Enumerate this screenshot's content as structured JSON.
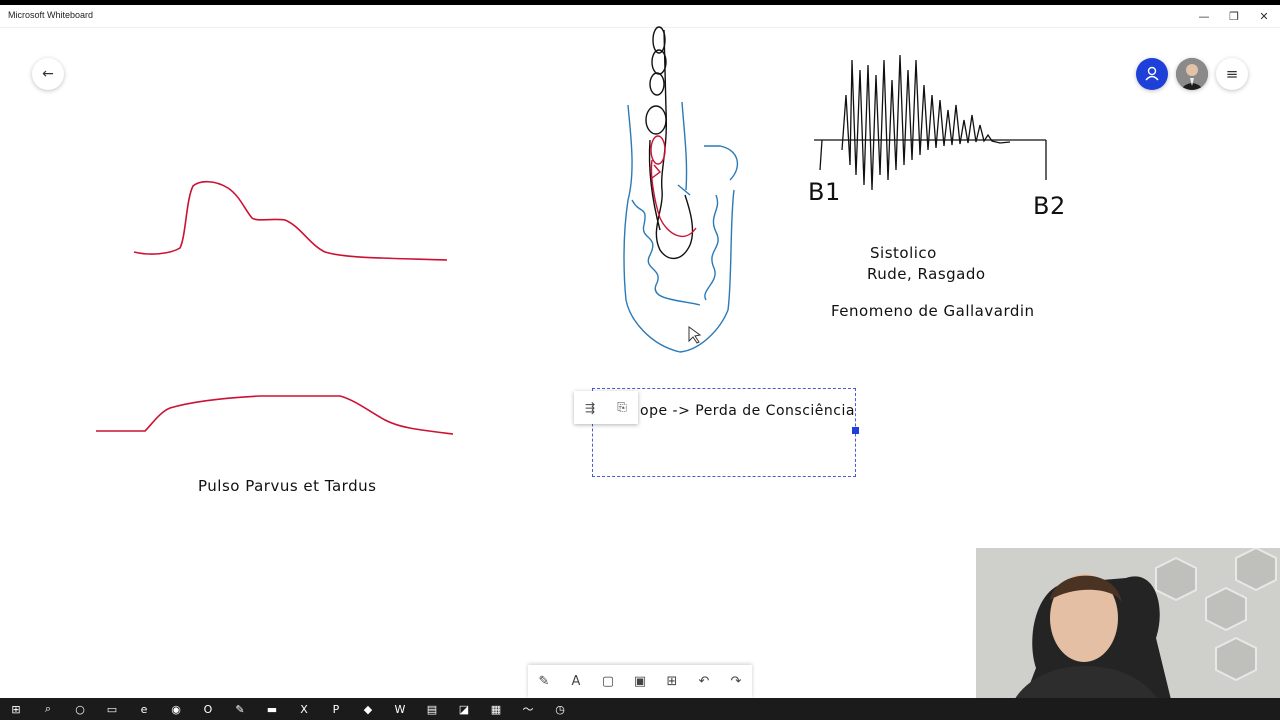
{
  "window": {
    "title": "Microsoft Whiteboard"
  },
  "window_controls": {
    "minimize": "—",
    "restore": "❐",
    "close": "✕"
  },
  "canvas_text": {
    "pulse_label": "Pulso Parvus et Tardus",
    "sistolico": "Sistolico",
    "rude": "Rude, Rasgado",
    "fenomeno": "Fenomeno de Gallavardin",
    "b1": "B1",
    "b2": "B2",
    "textbox": "ope -> Perda de Consciência"
  },
  "colors": {
    "red_ink": "#cc1133",
    "blue_ink": "#2a7ab8",
    "accent": "#1e3fd8"
  },
  "icons": {
    "back": "←",
    "menu": "≡",
    "user": "user-icon",
    "float_tool_1": "⇶",
    "float_tool_2": "⎘",
    "pen": "✎",
    "text": "A",
    "shape": "▢",
    "image": "▣",
    "insert": "⊞",
    "undo": "↶",
    "redo": "↷"
  },
  "taskbar": [
    "⊞",
    "⌕",
    "○",
    "▭",
    "e",
    "◉",
    "O",
    "✎",
    "▬",
    "X",
    "P",
    "◆",
    "W",
    "▤",
    "◪",
    "▦",
    "〜",
    "◷"
  ]
}
